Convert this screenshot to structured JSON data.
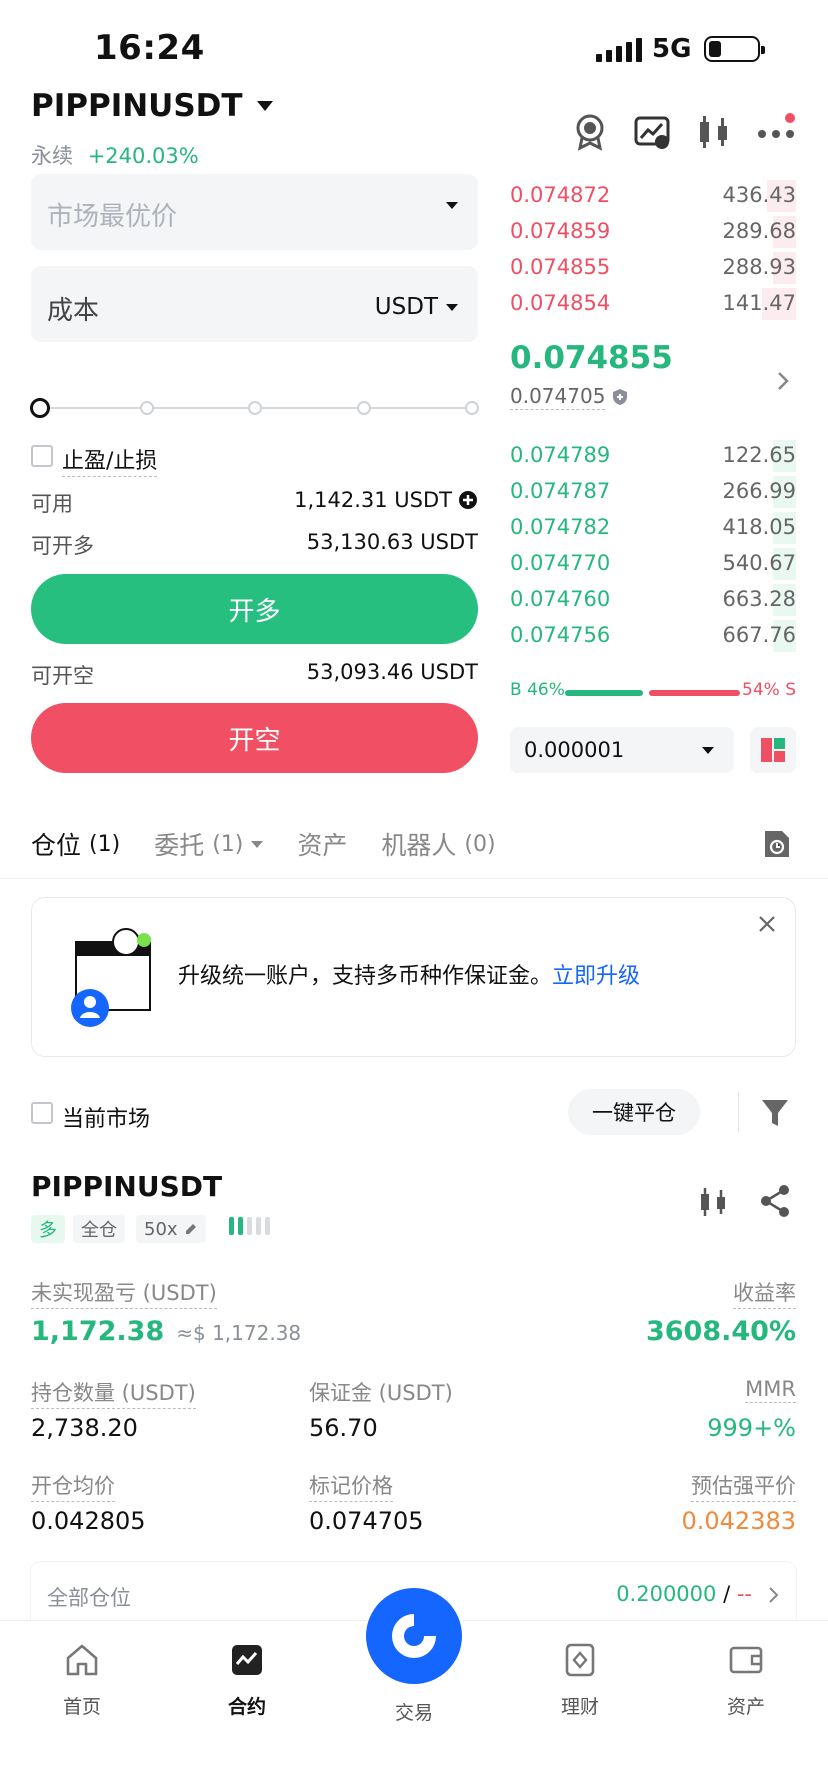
{
  "status": {
    "time": "16:24",
    "network": "5G"
  },
  "header": {
    "pair": "PIPPINUSDT",
    "contract_type": "永续",
    "change": "+240.03%",
    "icons": [
      "medal-icon",
      "chart-switch-icon",
      "candlestick-icon",
      "more-icon"
    ]
  },
  "order_form": {
    "price_placeholder": "市场最优价",
    "cost_label": "成本",
    "cost_unit": "USDT",
    "tpsl_label": "止盈/止损",
    "available_label": "可用",
    "available_value": "1,142.31 USDT",
    "can_long_label": "可开多",
    "can_long_value": "53,130.63 USDT",
    "long_button": "开多",
    "can_short_label": "可开空",
    "can_short_value": "53,093.46 USDT",
    "short_button": "开空",
    "leverage_slider_fraction": 0
  },
  "order_book": {
    "asks": [
      {
        "price": "0.074872",
        "qty": "436.43",
        "depth": 0.1
      },
      {
        "price": "0.074859",
        "qty": "289.68",
        "depth": 0.08
      },
      {
        "price": "0.074855",
        "qty": "288.93",
        "depth": 0.08
      },
      {
        "price": "0.074854",
        "qty": "141.47",
        "depth": 0.12
      }
    ],
    "last_price": "0.074855",
    "mark_price": "0.074705",
    "bids": [
      {
        "price": "0.074789",
        "qty": "122.65",
        "depth": 0.08
      },
      {
        "price": "0.074787",
        "qty": "266.99",
        "depth": 0.08
      },
      {
        "price": "0.074782",
        "qty": "418.05",
        "depth": 0.08
      },
      {
        "price": "0.074770",
        "qty": "540.67",
        "depth": 0.08
      },
      {
        "price": "0.074760",
        "qty": "663.28",
        "depth": 0.08
      },
      {
        "price": "0.074756",
        "qty": "667.76",
        "depth": 0.08
      }
    ],
    "buy_ratio": "B 46%",
    "sell_ratio": "54% S",
    "buy_fraction": 0.46,
    "precision": "0.000001"
  },
  "tabs": [
    {
      "label": "仓位",
      "count": "(1)"
    },
    {
      "label": "委托",
      "count": "(1)"
    },
    {
      "label": "资产",
      "count": ""
    },
    {
      "label": "机器人",
      "count": "(0)"
    }
  ],
  "banner": {
    "text": "升级统一账户，支持多币种作保证金。",
    "link": "立即升级"
  },
  "filter": {
    "current_market": "当前市场",
    "close_all": "一键平仓"
  },
  "position": {
    "symbol": "PIPPINUSDT",
    "side": "多",
    "margin_mode": "全仓",
    "leverage": "50x",
    "upnl_label": "未实现盈亏 (USDT)",
    "upnl_value": "1,172.38",
    "upnl_usd": "≈$ 1,172.38",
    "roe_label": "收益率",
    "roe_value": "3608.40%",
    "size_label": "持仓数量 (USDT)",
    "size_value": "2,738.20",
    "margin_label": "保证金 (USDT)",
    "margin_value": "56.70",
    "mmr_label": "MMR",
    "mmr_value": "999+%",
    "entry_label": "开仓均价",
    "entry_value": "0.042805",
    "markp_label": "标记价格",
    "markp_value": "0.074705",
    "liq_label": "预估强平价",
    "liq_value": "0.042383",
    "all_positions_label": "全部仓位",
    "all_positions_value": "0.200000",
    "all_positions_sep": "/",
    "all_positions_dash": "--"
  },
  "nav": [
    {
      "label": "首页",
      "icon": "home-icon"
    },
    {
      "label": "合约",
      "icon": "contract-icon"
    },
    {
      "label": "交易",
      "icon": "trade-icon"
    },
    {
      "label": "理财",
      "icon": "earn-icon"
    },
    {
      "label": "资产",
      "icon": "wallet-icon"
    }
  ],
  "colors": {
    "green": "#25b77d",
    "red": "#ef4f63",
    "blue": "#1565ff",
    "orange": "#f08a3c"
  }
}
